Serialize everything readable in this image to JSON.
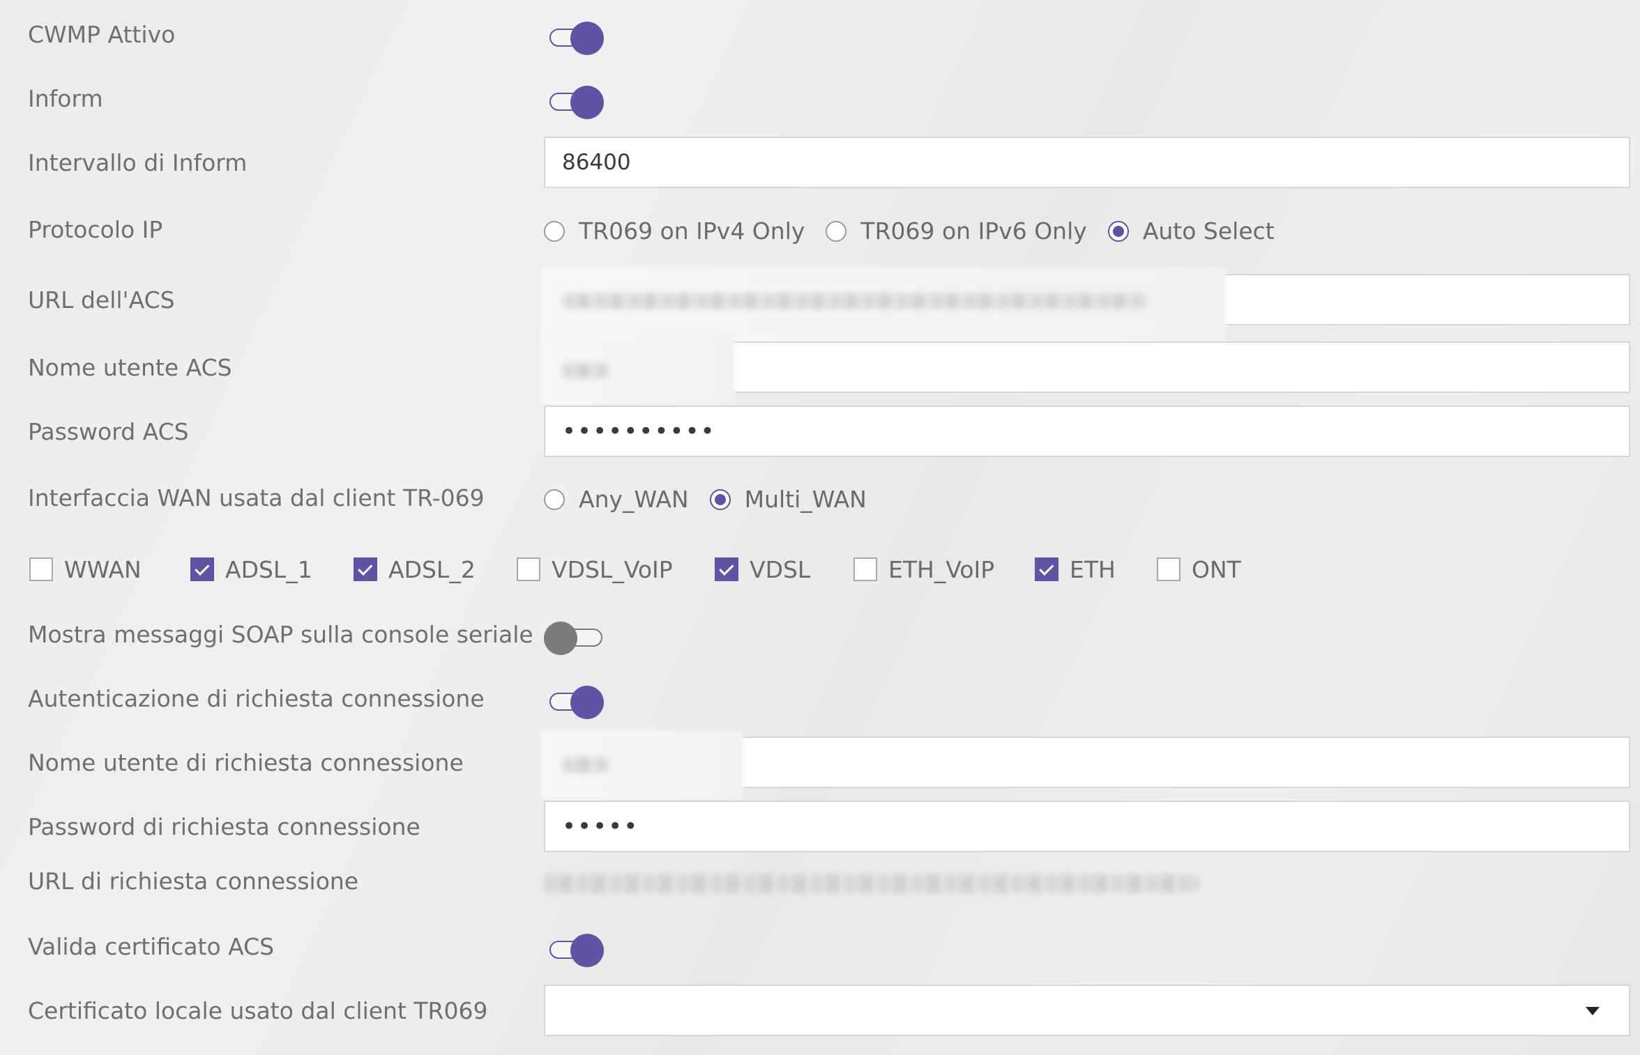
{
  "labels": {
    "cwmp_active": "CWMP Attivo",
    "inform": "Inform",
    "inform_interval": "Intervallo di Inform",
    "ip_protocol": "Protocolo IP",
    "acs_url": "URL dell'ACS",
    "acs_username": "Nome utente ACS",
    "acs_password": "Password ACS",
    "wan_interface": "Interfaccia WAN usata dal client TR-069",
    "show_soap": "Mostra messaggi SOAP sulla console seriale",
    "conn_req_auth": "Autenticazione di richiesta connessione",
    "conn_req_username": "Nome utente di richiesta connessione",
    "conn_req_password": "Password di richiesta connessione",
    "conn_req_url": "URL di richiesta connessione",
    "validate_cert": "Valida certificato ACS",
    "local_cert": "Certificato locale usato dal client TR069"
  },
  "values": {
    "cwmp_active": true,
    "inform": true,
    "inform_interval": "86400",
    "acs_password": "••••••••••",
    "show_soap": false,
    "conn_req_auth": true,
    "conn_req_password": "•••••",
    "validate_cert": true,
    "local_cert": ""
  },
  "ip_protocol_options": {
    "ipv4": "TR069 on IPv4 Only",
    "ipv6": "TR069 on IPv6 Only",
    "auto": "Auto Select",
    "selected": "Auto Select"
  },
  "wan_options": {
    "any": "Any_WAN",
    "multi": "Multi_WAN",
    "selected": "Multi_WAN"
  },
  "wan_checkboxes": [
    {
      "label": "WWAN",
      "checked": false
    },
    {
      "label": "ADSL_1",
      "checked": true
    },
    {
      "label": "ADSL_2",
      "checked": true
    },
    {
      "label": "VDSL_VoIP",
      "checked": false
    },
    {
      "label": "VDSL",
      "checked": true
    },
    {
      "label": "ETH_VoIP",
      "checked": false
    },
    {
      "label": "ETH",
      "checked": true
    },
    {
      "label": "ONT",
      "checked": false
    }
  ],
  "colors": {
    "accent": "#5f53a6",
    "toggle_off": "#7b7b7b"
  }
}
